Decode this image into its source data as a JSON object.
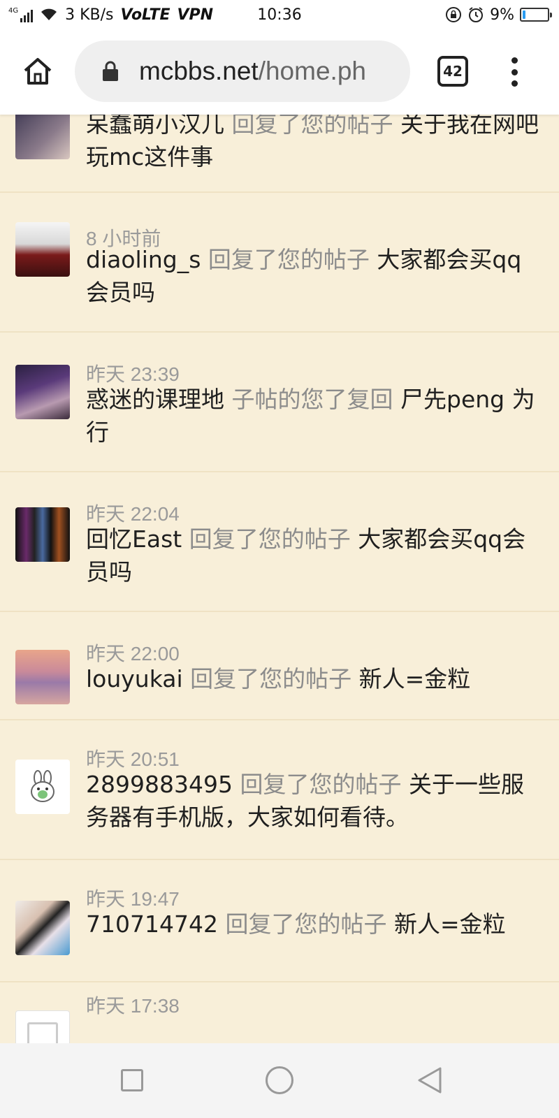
{
  "status_bar": {
    "network": "4G",
    "speed": "3 KB/s",
    "volte": "VoLTE",
    "vpn": "VPN",
    "time": "10:36",
    "battery": "9%"
  },
  "browser": {
    "url_domain": "mcbbs.net",
    "url_path": "/home.ph",
    "tab_count": "42"
  },
  "notifications": [
    {
      "time": "",
      "user": "呆蠢萌小汉儿",
      "action": "回复了您的帖子",
      "post": "关于我在网吧玩mc这件事"
    },
    {
      "time": "8 小时前",
      "user": "diaoling_s",
      "action": "回复了您的帖子",
      "post": "大家都会买qq会员吗"
    },
    {
      "time": "昨天 23:39",
      "user": "惑迷的课理地",
      "action": "子帖的您了复回",
      "post": "尸先peng  为行"
    },
    {
      "time": "昨天 22:04",
      "user": "回忆East",
      "action": "回复了您的帖子",
      "post": "大家都会买qq会员吗"
    },
    {
      "time": "昨天 22:00",
      "user": "louyukai",
      "action": "回复了您的帖子",
      "post": "新人=金粒"
    },
    {
      "time": "昨天 20:51",
      "user": "2899883495",
      "action": "回复了您的帖子",
      "post": "关于一些服务器有手机版，大家如何看待。"
    },
    {
      "time": "昨天 19:47",
      "user": "710714742",
      "action": "回复了您的帖子",
      "post": "新人=金粒"
    },
    {
      "time": "昨天 17:38",
      "user": "",
      "action": "",
      "post": ""
    }
  ]
}
